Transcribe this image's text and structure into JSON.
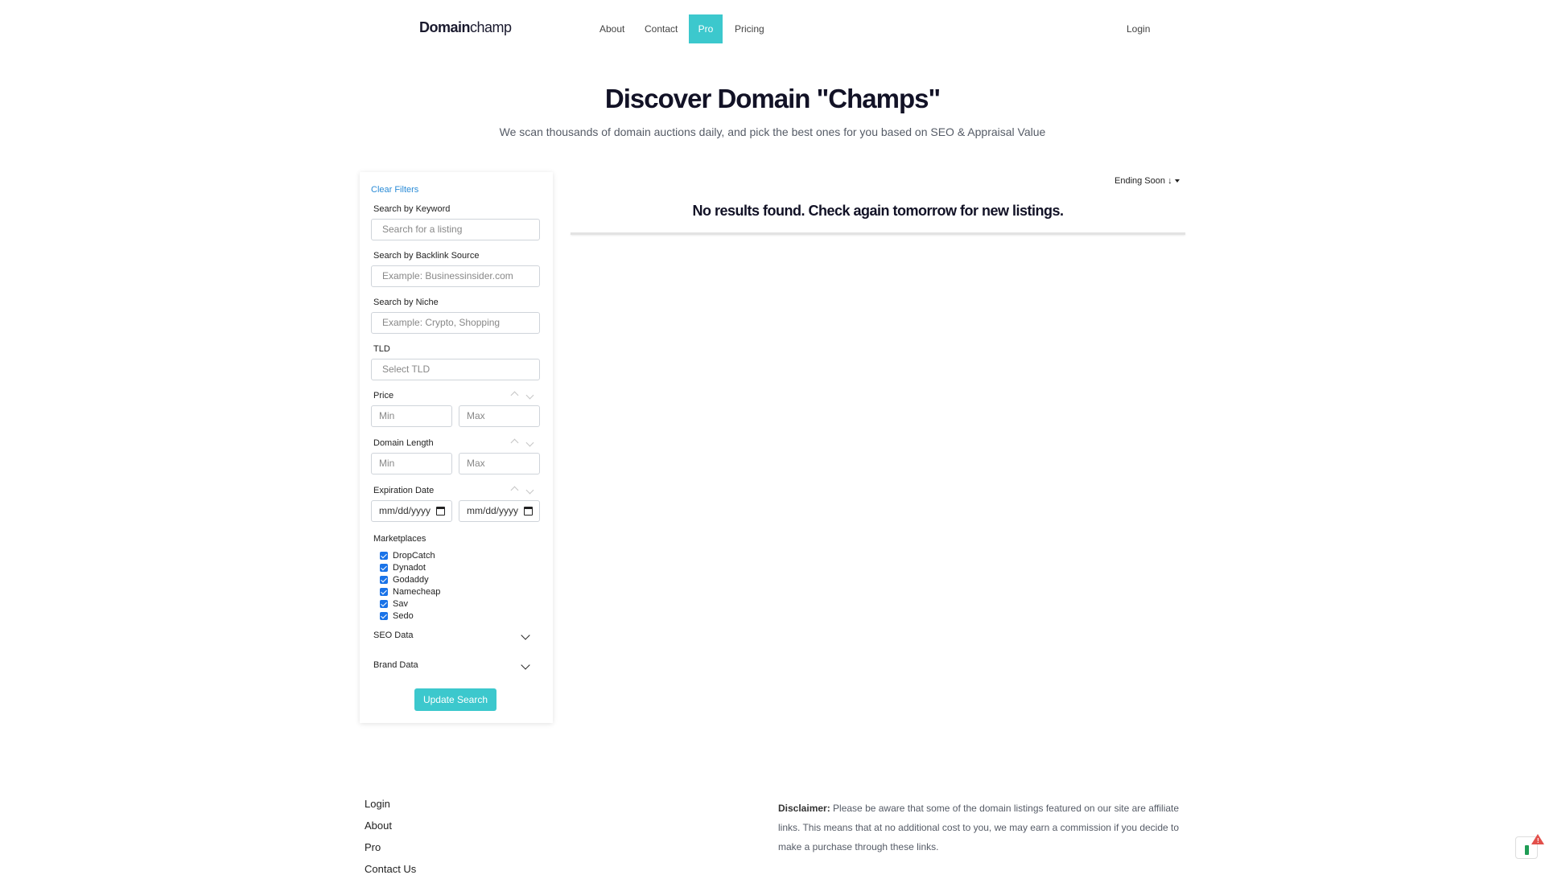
{
  "nav": {
    "logo_bold": "Domain",
    "logo_light": "champ",
    "about": "About",
    "contact": "Contact",
    "pro": "Pro",
    "pricing": "Pricing",
    "login": "Login"
  },
  "hero": {
    "title": "Discover Domain \"Champs\"",
    "subtitle": "We scan thousands of domain auctions daily, and pick the best ones for you based on SEO & Appraisal Value"
  },
  "filters": {
    "clear": "Clear Filters",
    "keyword_label": "Search by Keyword",
    "keyword_placeholder": "Search for a listing",
    "backlink_label": "Search by Backlink Source",
    "backlink_placeholder": "Example: Businessinsider.com",
    "niche_label": "Search by Niche",
    "niche_placeholder": "Example: Crypto, Shopping",
    "tld_label": "TLD",
    "tld_placeholder": "Select TLD",
    "price_label": "Price",
    "min": "Min",
    "max": "Max",
    "length_label": "Domain Length",
    "expiration_label": "Expiration Date",
    "date_placeholder": "mm/dd/yyyy",
    "marketplaces_label": "Marketplaces",
    "marketplaces": [
      {
        "label": "DropCatch",
        "checked": true
      },
      {
        "label": "Dynadot",
        "checked": true
      },
      {
        "label": "Godaddy",
        "checked": true
      },
      {
        "label": "Namecheap",
        "checked": true
      },
      {
        "label": "Sav",
        "checked": true
      },
      {
        "label": "Sedo",
        "checked": true
      }
    ],
    "seo_label": "SEO Data",
    "brand_label": "Brand Data",
    "update_button": "Update Search"
  },
  "results": {
    "sort_label": "Ending Soon",
    "sort_arrow": "↓",
    "empty_message": "No results found. Check again tomorrow for new listings."
  },
  "footer": {
    "links": [
      "Login",
      "About",
      "Pro",
      "Contact Us"
    ],
    "disclaimer_label": "Disclaimer:",
    "disclaimer_text": " Please be aware that some of the domain listings featured on our site are affiliate links. This means that at no additional cost to you, we may earn a commission if you decide to make a purchase through these links."
  },
  "colors": {
    "accent": "#3cc8cd",
    "link": "#2a8bd6",
    "checkbox": "#1a73e8"
  }
}
